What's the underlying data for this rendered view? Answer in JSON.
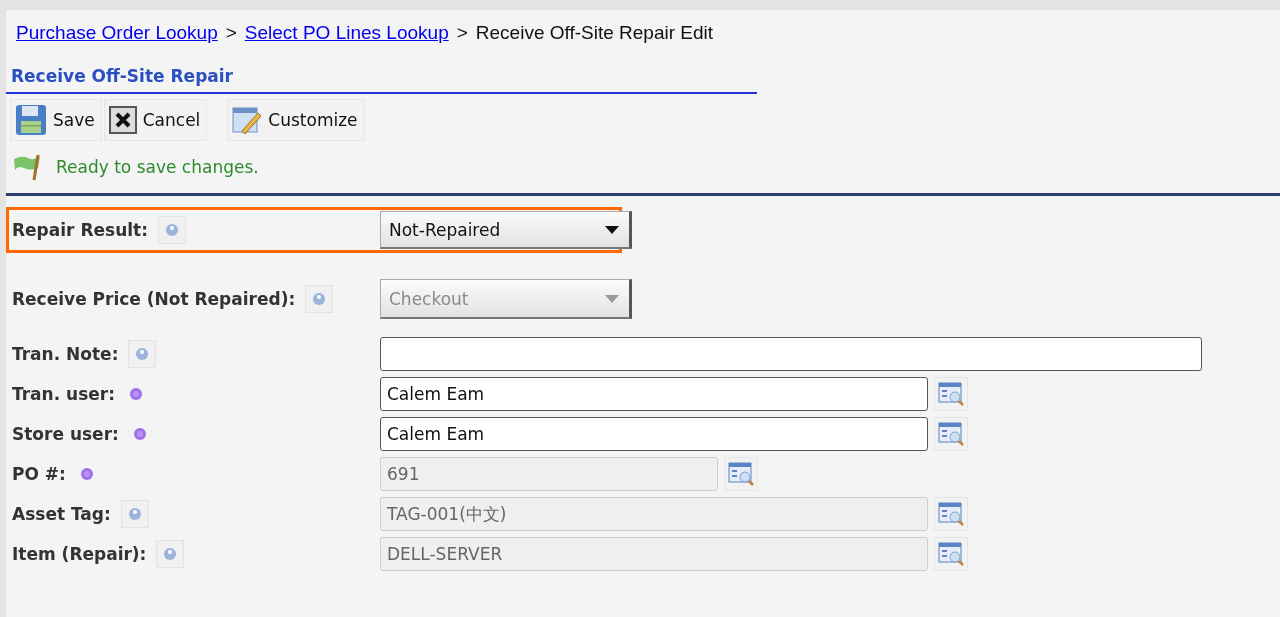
{
  "breadcrumb": [
    {
      "label": "Purchase Order Lookup",
      "link": true
    },
    {
      "label": "Select PO Lines Lookup",
      "link": true
    },
    {
      "label": "Receive Off-Site Repair Edit",
      "link": false
    }
  ],
  "breadcrumb_separator": ">",
  "title": "Receive Off-Site Repair",
  "toolbar": [
    {
      "kind": "save",
      "label": "Save"
    },
    {
      "kind": "cancel",
      "label": "Cancel"
    },
    {
      "kind": "customize",
      "label": "Customize"
    }
  ],
  "status": "Ready to save changes.",
  "fields": [
    {
      "label": "Repair Result:",
      "required": false,
      "kind": "select",
      "value": "Not-Repaired",
      "disabled": false,
      "highlighted": true
    },
    {
      "label": "Receive Price (Not Repaired):",
      "required": false,
      "kind": "select",
      "value": "Checkout",
      "disabled": true,
      "highlighted": false
    },
    {
      "label": "Tran. Note:",
      "required": false,
      "kind": "text",
      "disabled": false,
      "highlighted": false
    },
    {
      "label": "Tran. user:",
      "required": true,
      "kind": "lookup",
      "value": "Calem Eam",
      "disabled": false,
      "highlighted": false
    },
    {
      "label": "Store user:",
      "required": true,
      "kind": "lookup",
      "value": "Calem Eam",
      "disabled": false,
      "highlighted": false
    },
    {
      "label": "PO #:",
      "required": true,
      "kind": "shortlookup",
      "value": "691",
      "disabled": true,
      "highlighted": false
    },
    {
      "label": "Asset Tag:",
      "required": false,
      "kind": "lookup",
      "value": "TAG-001(中文)",
      "disabled": true,
      "highlighted": false
    },
    {
      "label": "Item (Repair):",
      "required": false,
      "kind": "lookup",
      "value": "DELL-SERVER",
      "disabled": true,
      "highlighted": false
    }
  ]
}
